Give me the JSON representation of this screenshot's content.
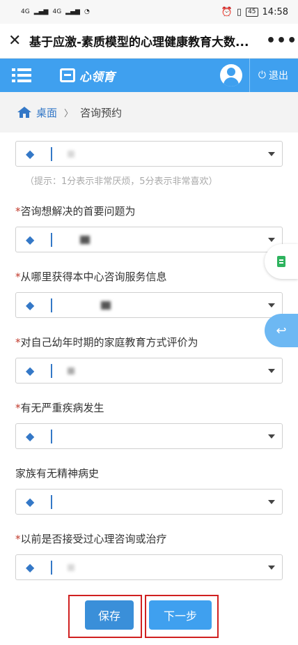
{
  "status_bar": {
    "network": "4G",
    "battery": "45",
    "time": "14:58"
  },
  "titlebar": {
    "title": "基于应激-素质模型的心理健康教育大数...",
    "close_icon": "close-icon",
    "more_label": "•••"
  },
  "appbar": {
    "logo_text": "心领育",
    "logout_label": "退出",
    "color": "#3fa0ef"
  },
  "breadcrumb": {
    "home": "桌面",
    "current": "咨询预约"
  },
  "form": {
    "hint": "（提示：1分表示非常厌烦，5分表示非常喜欢）",
    "required_mark": "*",
    "fields": [
      {
        "label": "咨询想解决的首要问题为",
        "required": true
      },
      {
        "label": "从哪里获得本中心咨询服务信息",
        "required": true
      },
      {
        "label": "对自己幼年时期的家庭教育方式评价为",
        "required": true
      },
      {
        "label": "有无严重疾病发生",
        "required": true
      },
      {
        "label": "家族有无精神病史",
        "required": false
      },
      {
        "label": "以前是否接受过心理咨询或治疗",
        "required": true
      }
    ]
  },
  "buttons": {
    "save": "保存",
    "next": "下一步"
  }
}
